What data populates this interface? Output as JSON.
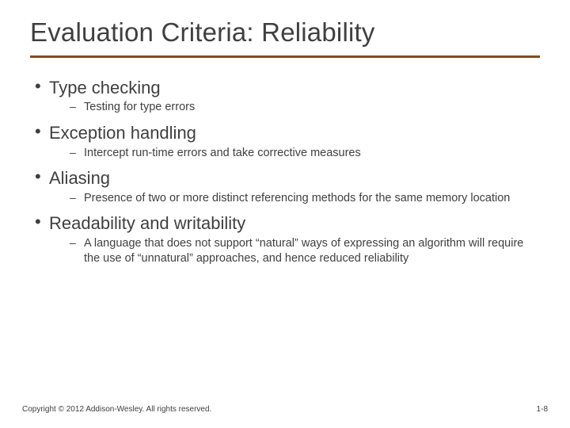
{
  "title": "Evaluation Criteria: Reliability",
  "bullets": [
    {
      "text": "Type checking",
      "subs": [
        "Testing for type errors"
      ]
    },
    {
      "text": "Exception handling",
      "subs": [
        "Intercept run-time errors and take corrective measures"
      ]
    },
    {
      "text": "Aliasing",
      "subs": [
        "Presence of two or more distinct referencing methods for the same memory location"
      ]
    },
    {
      "text": "Readability and writability",
      "subs": [
        "A language that does not support “natural” ways of expressing an algorithm will require the use  of “unnatural” approaches, and hence reduced reliability"
      ]
    }
  ],
  "footer": {
    "copyright": "Copyright © 2012 Addison-Wesley. All rights reserved.",
    "pagenum": "1-8"
  }
}
